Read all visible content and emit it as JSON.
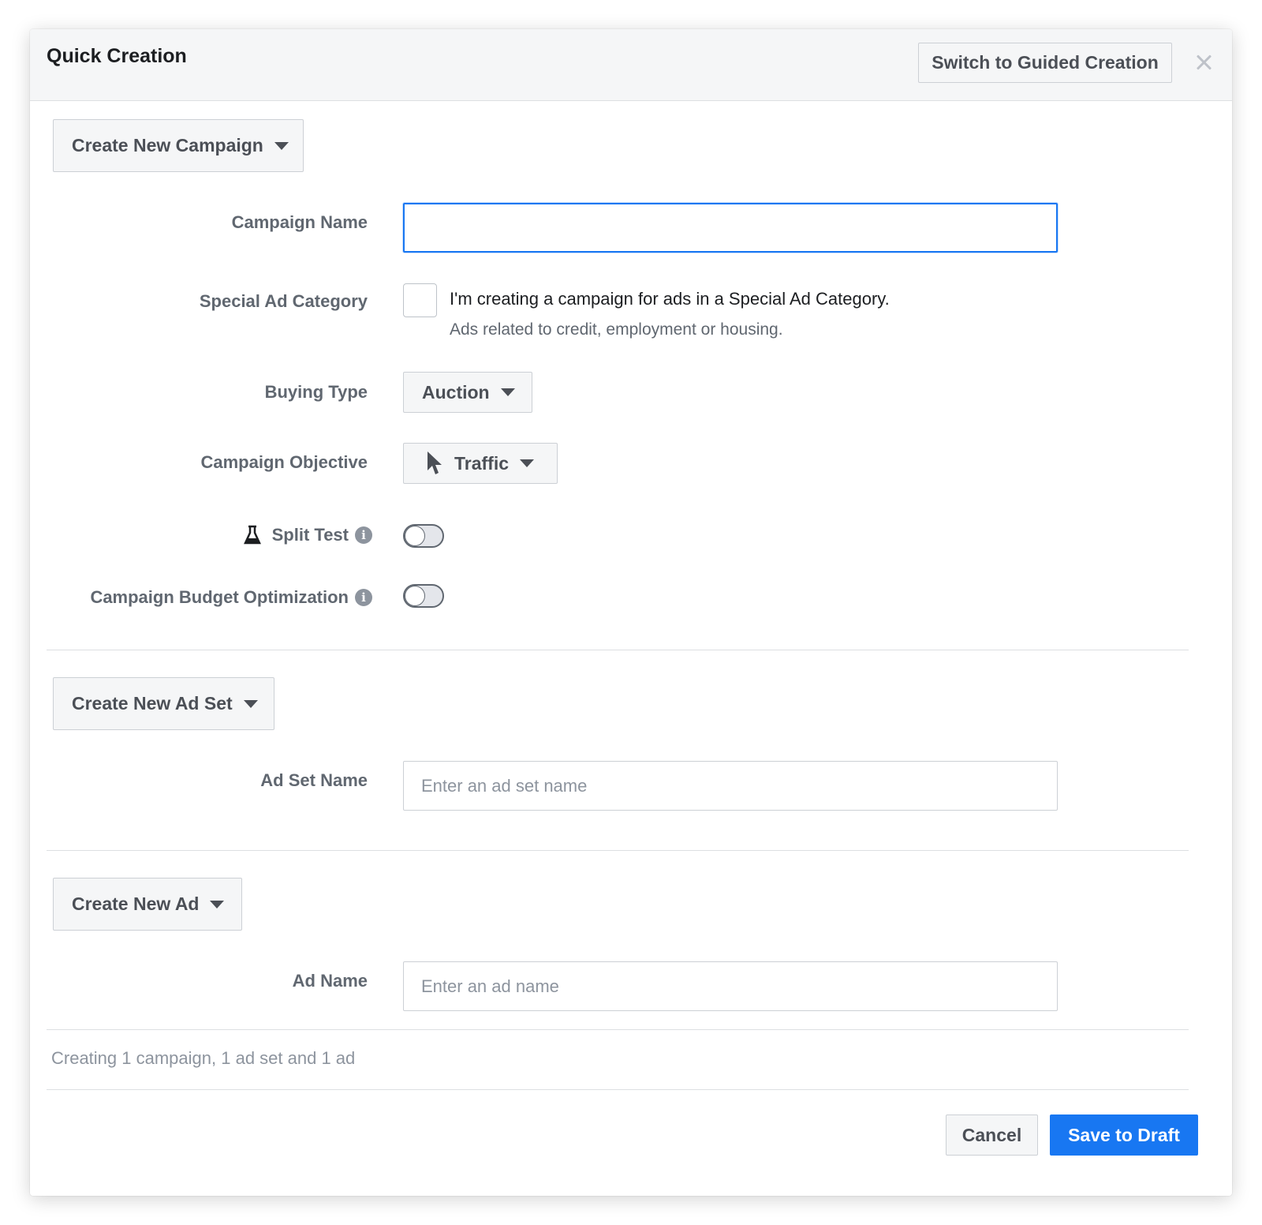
{
  "dialog": {
    "title": "Quick Creation",
    "switch_button": "Switch to Guided Creation"
  },
  "campaign": {
    "dropdown_label": "Create New Campaign",
    "name_label": "Campaign Name",
    "name_value": "",
    "special_category_label": "Special Ad Category",
    "special_category_checkbox_text": "I'm creating a campaign for ads in a Special Ad Category.",
    "special_category_subtext": "Ads related to credit, employment or housing.",
    "special_category_checked": false,
    "buying_type_label": "Buying Type",
    "buying_type_value": "Auction",
    "objective_label": "Campaign Objective",
    "objective_value": "Traffic",
    "split_test_label": "Split Test",
    "split_test_on": false,
    "budget_opt_label": "Campaign Budget Optimization",
    "budget_opt_on": false
  },
  "ad_set": {
    "dropdown_label": "Create New Ad Set",
    "name_label": "Ad Set Name",
    "name_placeholder": "Enter an ad set name"
  },
  "ad": {
    "dropdown_label": "Create New Ad",
    "name_label": "Ad Name",
    "name_placeholder": "Enter an ad name"
  },
  "footer": {
    "summary": "Creating 1 campaign, 1 ad set and 1 ad",
    "cancel_label": "Cancel",
    "save_label": "Save to Draft"
  },
  "colors": {
    "primary": "#1877f2",
    "header_bg": "#f5f6f7",
    "border": "#ccd0d5"
  },
  "icons": [
    "close-icon",
    "caret-down-icon",
    "cursor-icon",
    "flask-icon",
    "info-icon"
  ]
}
